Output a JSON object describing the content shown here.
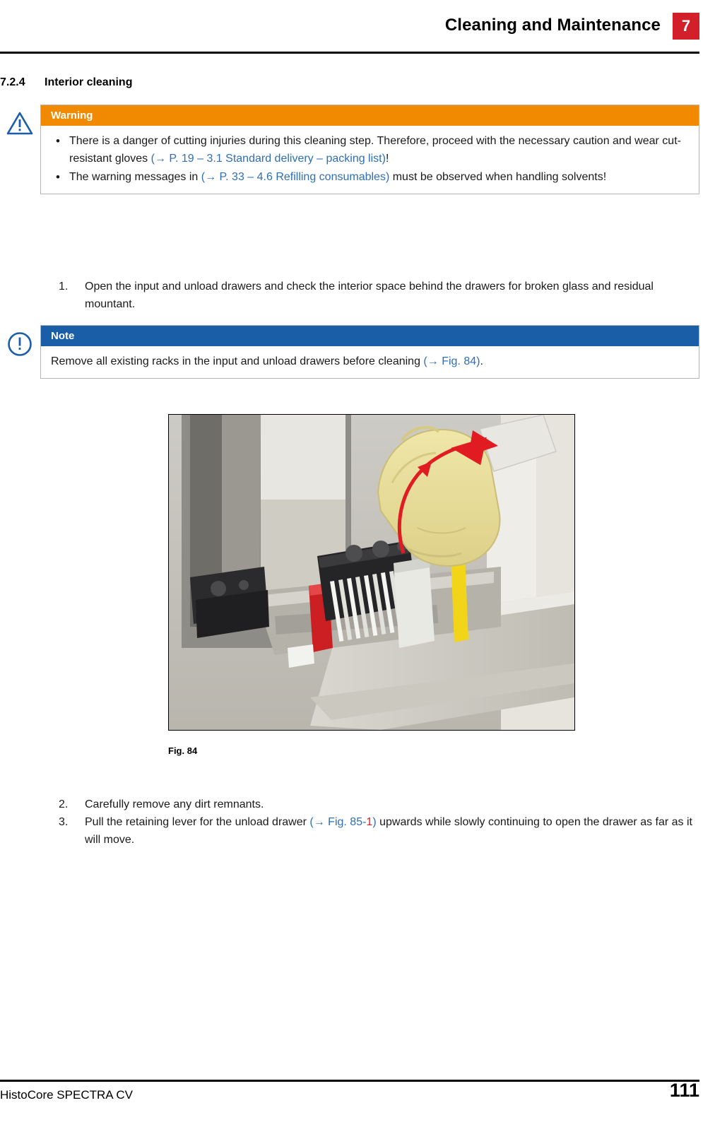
{
  "header": {
    "title": "Cleaning and Maintenance",
    "chapter": "7"
  },
  "section": {
    "number": "7.2.4",
    "title": "Interior cleaning"
  },
  "warning": {
    "label": "Warning",
    "icon": "warning-triangle-icon",
    "accent": "#f18a00",
    "bullets": [
      {
        "parts": [
          {
            "text": "There is a danger of cutting injuries during this cleaning step. Therefore, proceed with the necessary caution and wear cut-resistant gloves ",
            "style": "plain"
          },
          {
            "text": "(→ P. 19 – 3.1 Standard delivery – packing list)",
            "style": "xref"
          },
          {
            "text": "!",
            "style": "plain"
          }
        ]
      },
      {
        "parts": [
          {
            "text": "The warning messages in ",
            "style": "plain"
          },
          {
            "text": "(→ P. 33 – 4.6 Refilling consumables)",
            "style": "xref"
          },
          {
            "text": " must be observed when handling solvents!",
            "style": "plain"
          }
        ]
      }
    ]
  },
  "note": {
    "label": "Note",
    "icon": "note-exclamation-icon",
    "accent": "#1b5ea8",
    "text_parts": [
      {
        "text": "Remove all existing racks in the input and unload drawers before cleaning ",
        "style": "plain"
      },
      {
        "text": "(→ Fig.  84)",
        "style": "xref"
      },
      {
        "text": ".",
        "style": "plain"
      }
    ]
  },
  "steps_before_figure": [
    {
      "number": "1.",
      "parts": [
        {
          "text": "Open the input and unload drawers and check the interior space behind the drawers for broken glass and residual mountant.",
          "style": "plain"
        }
      ]
    }
  ],
  "steps_after_figure": [
    {
      "number": "2.",
      "parts": [
        {
          "text": "Carefully remove any dirt remnants.",
          "style": "plain"
        }
      ]
    },
    {
      "number": "3.",
      "parts": [
        {
          "text": "Pull the retaining lever for the unload drawer ",
          "style": "plain"
        },
        {
          "text": "(→ Fig.  85-",
          "style": "xref"
        },
        {
          "text": "1",
          "style": "xref-red"
        },
        {
          "text": ")",
          "style": "xref"
        },
        {
          "text": " upwards while slowly continuing to open the drawer as far as it will move.",
          "style": "plain"
        }
      ]
    }
  ],
  "figure": {
    "caption": "Fig.  84",
    "description": "Photo of an open instrument drawer with a gloved hand lifting a slide rack; red curved arrow indicates upward lifting motion."
  },
  "footer": {
    "product": "HistoCore SPECTRA CV",
    "page": "111"
  }
}
